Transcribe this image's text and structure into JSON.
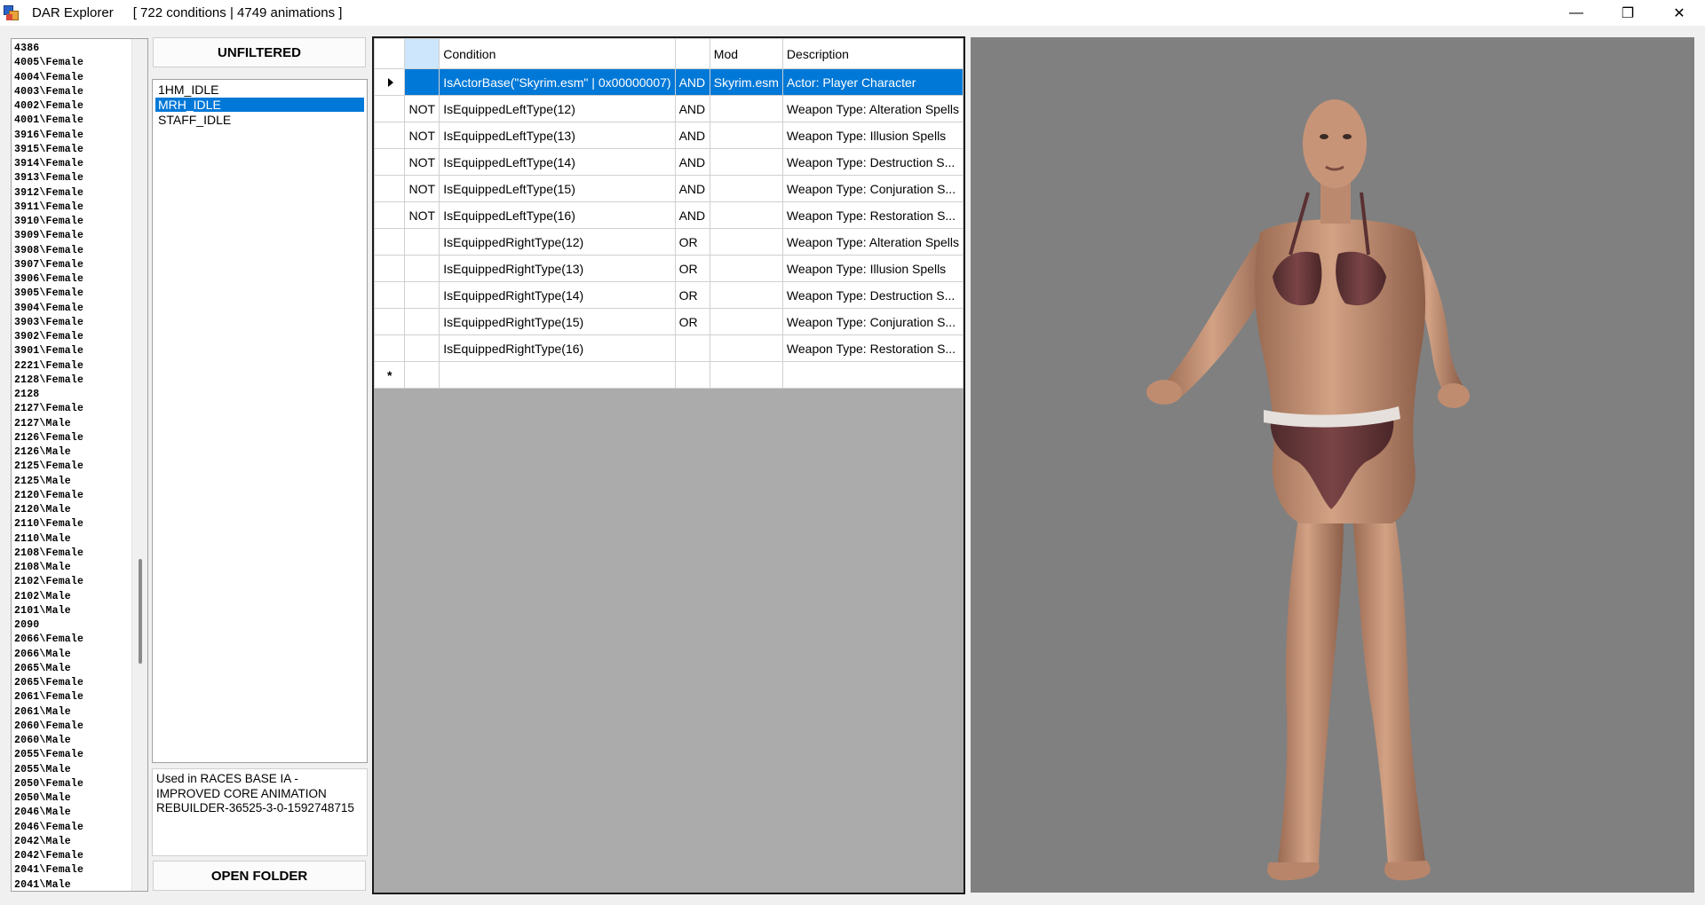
{
  "titlebar": {
    "app_name": "DAR Explorer",
    "subtitle": "[ 722 conditions | 4749 animations ]",
    "minimize": "—",
    "restore": "❐",
    "close": "✕"
  },
  "left_list": {
    "items": [
      "4386",
      "4005\\Female",
      "4004\\Female",
      "4003\\Female",
      "4002\\Female",
      "4001\\Female",
      "3916\\Female",
      "3915\\Female",
      "3914\\Female",
      "3913\\Female",
      "3912\\Female",
      "3911\\Female",
      "3910\\Female",
      "3909\\Female",
      "3908\\Female",
      "3907\\Female",
      "3906\\Female",
      "3905\\Female",
      "3904\\Female",
      "3903\\Female",
      "3902\\Female",
      "3901\\Female",
      "2221\\Female",
      "2128\\Female",
      "2128",
      "2127\\Female",
      "2127\\Male",
      "2126\\Female",
      "2126\\Male",
      "2125\\Female",
      "2125\\Male",
      "2120\\Female",
      "2120\\Male",
      "2110\\Female",
      "2110\\Male",
      "2108\\Female",
      "2108\\Male",
      "2102\\Female",
      "2102\\Male",
      "2101\\Male",
      "2090",
      "2066\\Female",
      "2066\\Male",
      "2065\\Male",
      "2065\\Female",
      "2061\\Female",
      "2061\\Male",
      "2060\\Female",
      "2060\\Male",
      "2055\\Female",
      "2055\\Male",
      "2050\\Female",
      "2050\\Male",
      "2046\\Male",
      "2046\\Female",
      "2042\\Male",
      "2042\\Female",
      "2041\\Female",
      "2041\\Male"
    ]
  },
  "unfiltered_button": "UNFILTERED",
  "open_folder_button": "OPEN FOLDER",
  "idle_list": {
    "items": [
      "1HM_IDLE",
      "MRH_IDLE",
      "STAFF_IDLE"
    ],
    "selected_index": 1
  },
  "info_text": "Used in RACES BASE IA - IMPROVED CORE ANIMATION REBUILDER-36525-3-0-1592748715",
  "grid": {
    "columns": [
      "",
      "",
      "Condition",
      "",
      "Mod",
      "Description"
    ],
    "rows": [
      {
        "neg": "",
        "cond": "IsActorBase(\"Skyrim.esm\" | 0x00000007)",
        "op": "AND",
        "mod": "Skyrim.esm",
        "desc": "Actor: Player Character"
      },
      {
        "neg": "NOT",
        "cond": "IsEquippedLeftType(12)",
        "op": "AND",
        "mod": "",
        "desc": "Weapon Type: Alteration Spells"
      },
      {
        "neg": "NOT",
        "cond": "IsEquippedLeftType(13)",
        "op": "AND",
        "mod": "",
        "desc": "Weapon Type: Illusion Spells"
      },
      {
        "neg": "NOT",
        "cond": "IsEquippedLeftType(14)",
        "op": "AND",
        "mod": "",
        "desc": "Weapon Type: Destruction S..."
      },
      {
        "neg": "NOT",
        "cond": "IsEquippedLeftType(15)",
        "op": "AND",
        "mod": "",
        "desc": "Weapon Type: Conjuration S..."
      },
      {
        "neg": "NOT",
        "cond": "IsEquippedLeftType(16)",
        "op": "AND",
        "mod": "",
        "desc": "Weapon Type: Restoration S..."
      },
      {
        "neg": "",
        "cond": "IsEquippedRightType(12)",
        "op": "OR",
        "mod": "",
        "desc": "Weapon Type: Alteration Spells"
      },
      {
        "neg": "",
        "cond": "IsEquippedRightType(13)",
        "op": "OR",
        "mod": "",
        "desc": "Weapon Type: Illusion Spells"
      },
      {
        "neg": "",
        "cond": "IsEquippedRightType(14)",
        "op": "OR",
        "mod": "",
        "desc": "Weapon Type: Destruction S..."
      },
      {
        "neg": "",
        "cond": "IsEquippedRightType(15)",
        "op": "OR",
        "mod": "",
        "desc": "Weapon Type: Conjuration S..."
      },
      {
        "neg": "",
        "cond": "IsEquippedRightType(16)",
        "op": "",
        "mod": "",
        "desc": "Weapon Type: Restoration S..."
      }
    ],
    "new_row_marker": "*",
    "selected_row": 0
  },
  "colors": {
    "selection": "#0078d7",
    "preview_bg": "#808080",
    "skin": "#c89478",
    "garment": "#6a3a3c"
  },
  "icons": {
    "app": "dar-explorer-icon",
    "row_pointer": "current-row-arrow-icon",
    "new_row": "new-row-star-icon"
  }
}
